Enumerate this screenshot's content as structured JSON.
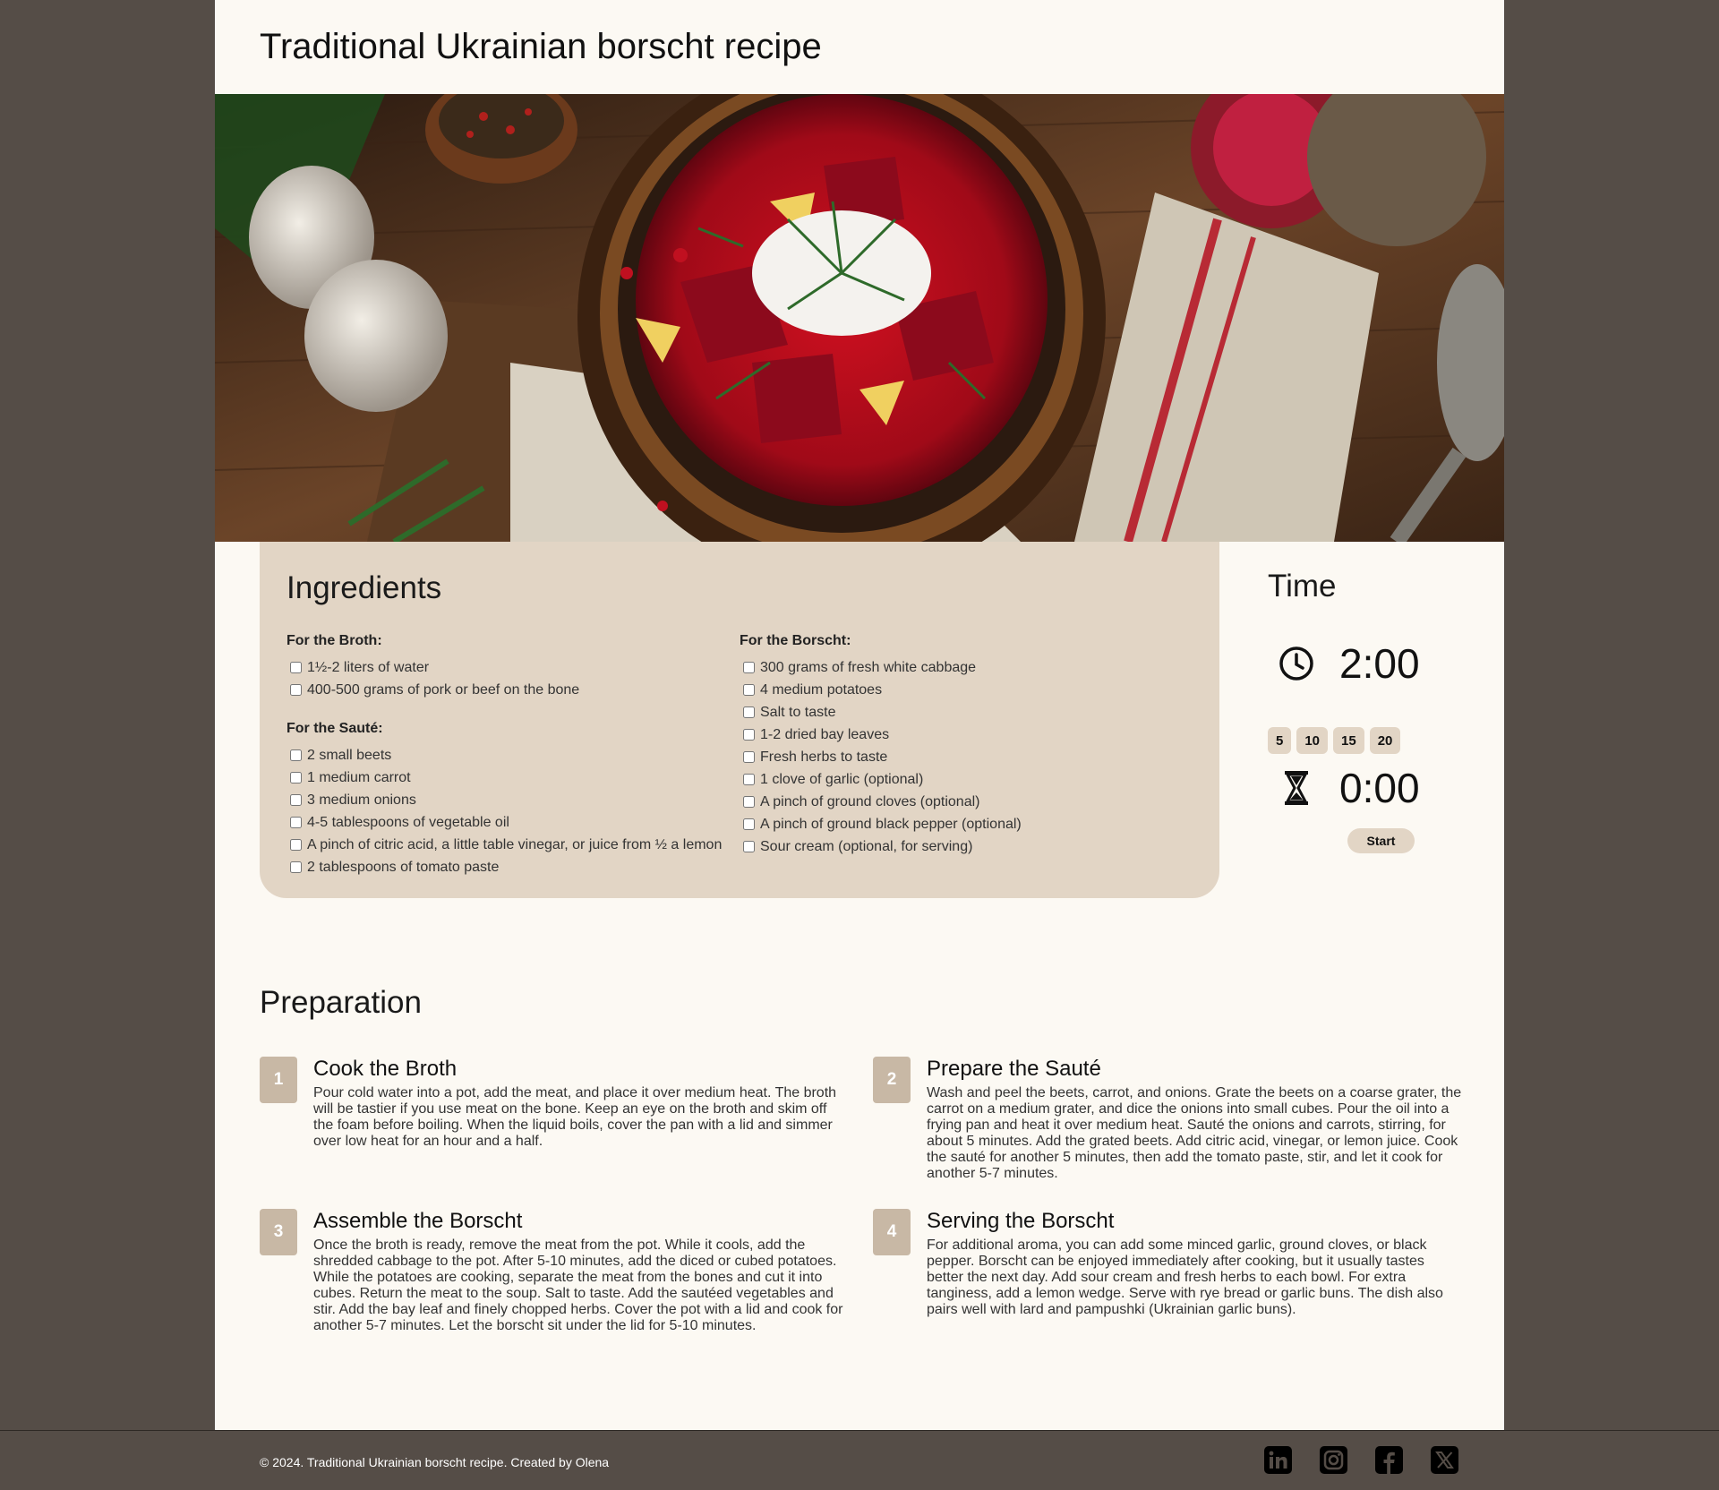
{
  "header": {
    "title": "Traditional Ukrainian borscht recipe"
  },
  "hero": {
    "alt": "Bowl of borscht with sour cream and dill, garlic, beets and spoon on wooden table"
  },
  "ingredients": {
    "title": "Ingredients",
    "groups": [
      {
        "title": "For the Broth:",
        "items": [
          "1½-2 liters of water",
          "400-500 grams of pork or beef on the bone"
        ]
      },
      {
        "title": "For the Sauté:",
        "items": [
          "2 small beets",
          "1 medium carrot",
          "3 medium onions",
          "4-5 tablespoons of vegetable oil",
          "A pinch of citric acid, a little table vinegar, or juice from ½ a lemon",
          "2 tablespoons of tomato paste"
        ]
      },
      {
        "title": "For the Borscht:",
        "items": [
          "300 grams of fresh white cabbage",
          "4 medium potatoes",
          "Salt to taste",
          "1-2 dried bay leaves",
          "Fresh herbs to taste",
          "1 clove of garlic (optional)",
          "A pinch of ground cloves (optional)",
          "A pinch of ground black pepper (optional)",
          "Sour cream (optional, for serving)"
        ]
      }
    ]
  },
  "time": {
    "title": "Time",
    "total": "2:00",
    "presets": [
      "5",
      "10",
      "15",
      "20"
    ],
    "timer": "0:00",
    "start_label": "Start",
    "clock_icon": "clock-icon",
    "timer_icon": "hourglass-icon"
  },
  "preparation": {
    "title": "Preparation",
    "steps": [
      {
        "num": "1",
        "title": "Cook the Broth",
        "text": "Pour cold water into a pot, add the meat, and place it over medium heat. The broth will be tastier if you use meat on the bone. Keep an eye on the broth and skim off the foam before boiling. When the liquid boils, cover the pan with a lid and simmer over low heat for an hour and a half."
      },
      {
        "num": "2",
        "title": "Prepare the Sauté",
        "text": "Wash and peel the beets, carrot, and onions. Grate the beets on a coarse grater, the carrot on a medium grater, and dice the onions into small cubes. Pour the oil into a frying pan and heat it over medium heat. Sauté the onions and carrots, stirring, for about 5 minutes. Add the grated beets. Add citric acid, vinegar, or lemon juice. Cook the sauté for another 5 minutes, then add the tomato paste, stir, and let it cook for another 5-7 minutes."
      },
      {
        "num": "3",
        "title": "Assemble the Borscht",
        "text": "Once the broth is ready, remove the meat from the pot. While it cools, add the shredded cabbage to the pot. After 5-10 minutes, add the diced or cubed potatoes. While the potatoes are cooking, separate the meat from the bones and cut it into cubes. Return the meat to the soup. Salt to taste. Add the sautéed vegetables and stir. Add the bay leaf and finely chopped herbs. Cover the pot with a lid and cook for another 5-7 minutes. Let the borscht sit under the lid for 5-10 minutes."
      },
      {
        "num": "4",
        "title": "Serving the Borscht",
        "text": "For additional aroma, you can add some minced garlic, ground cloves, or black pepper. Borscht can be enjoyed immediately after cooking, but it usually tastes better the next day. Add sour cream and fresh herbs to each bowl. For extra tanginess, add a lemon wedge. Serve with rye bread or garlic buns. The dish also pairs well with lard and pampushki (Ukrainian garlic buns)."
      }
    ]
  },
  "footer": {
    "copyright": "© 2024. Traditional Ukrainian borscht recipe. Created by Olena",
    "socials": [
      "linkedin-icon",
      "instagram-icon",
      "facebook-icon",
      "x-icon"
    ]
  },
  "colors": {
    "background": "#554d47",
    "page": "#fcf9f3",
    "panel": "#e2d5c5",
    "step_badge": "#c8b8a5"
  }
}
